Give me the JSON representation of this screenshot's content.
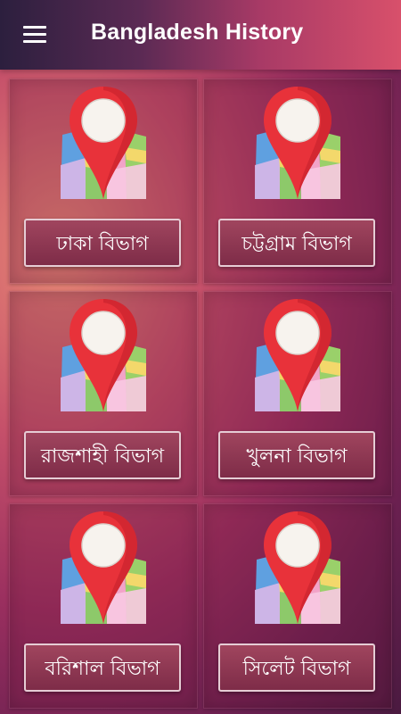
{
  "appbar": {
    "title": "Bangladesh History",
    "menu_icon": "hamburger-menu-icon"
  },
  "divisions": [
    {
      "label": "ঢাকা বিভাগ",
      "icon": "map-pin-icon"
    },
    {
      "label": "চট্টগ্রাম বিভাগ",
      "icon": "map-pin-icon"
    },
    {
      "label": "রাজশাহী বিভাগ",
      "icon": "map-pin-icon"
    },
    {
      "label": "খুলনা বিভাগ",
      "icon": "map-pin-icon"
    },
    {
      "label": "বরিশাল বিভাগ",
      "icon": "map-pin-icon"
    },
    {
      "label": "সিলেট বিভাগ",
      "icon": "map-pin-icon"
    }
  ],
  "colors": {
    "pin_red": "#e8323a",
    "button_border": "#e6cdd5"
  }
}
